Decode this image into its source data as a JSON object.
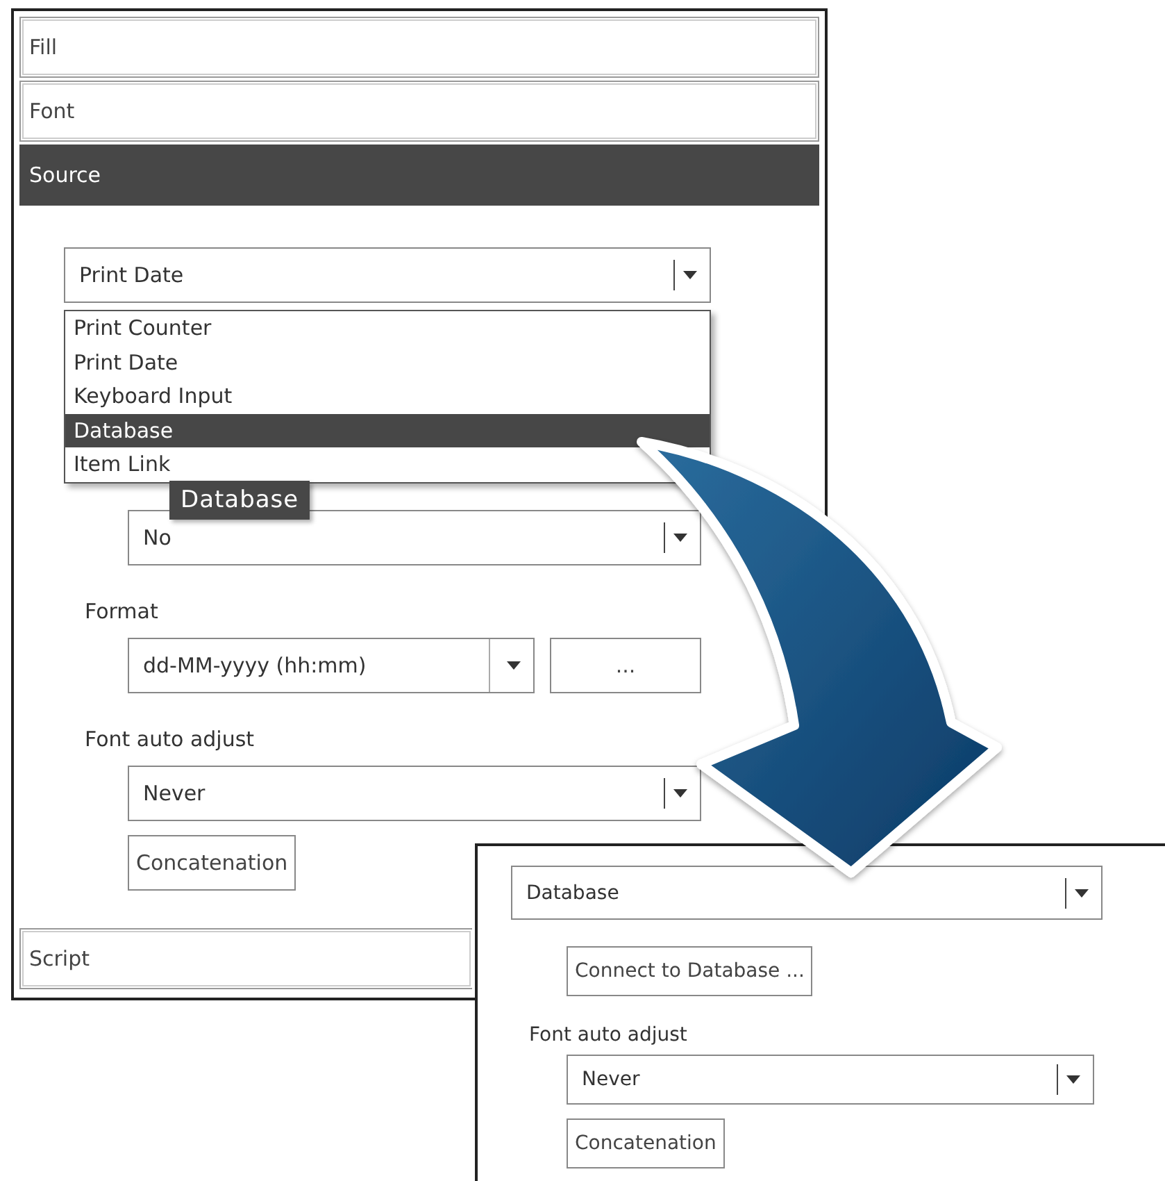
{
  "main_panel": {
    "sections": [
      {
        "label": "Fill",
        "selected": false
      },
      {
        "label": "Font",
        "selected": false
      },
      {
        "label": "Source",
        "selected": true
      }
    ],
    "source_select": {
      "value": "Print Date"
    },
    "source_options": [
      {
        "label": "Print Counter",
        "selected": false
      },
      {
        "label": "Print Date",
        "selected": false
      },
      {
        "label": "Keyboard Input",
        "selected": false
      },
      {
        "label": "Database",
        "selected": true
      },
      {
        "label": "Item Link",
        "selected": false
      }
    ],
    "tooltip": "Database",
    "save_select": {
      "value": "No"
    },
    "format_label": "Format",
    "format_select": {
      "value": "dd-MM-yyyy (hh:mm)"
    },
    "format_button": "...",
    "font_auto_adjust_label": "Font auto adjust",
    "font_auto_adjust_select": {
      "value": "Never"
    },
    "concatenation_button": "Concatenation",
    "footer_sections": [
      {
        "label": "Script",
        "selected": false
      }
    ]
  },
  "result_panel": {
    "source_select": {
      "value": "Database"
    },
    "connect_button": "Connect to Database ...",
    "font_auto_adjust_label": "Font auto adjust",
    "font_auto_adjust_select": {
      "value": "Never"
    },
    "concatenation_button": "Concatenation"
  }
}
